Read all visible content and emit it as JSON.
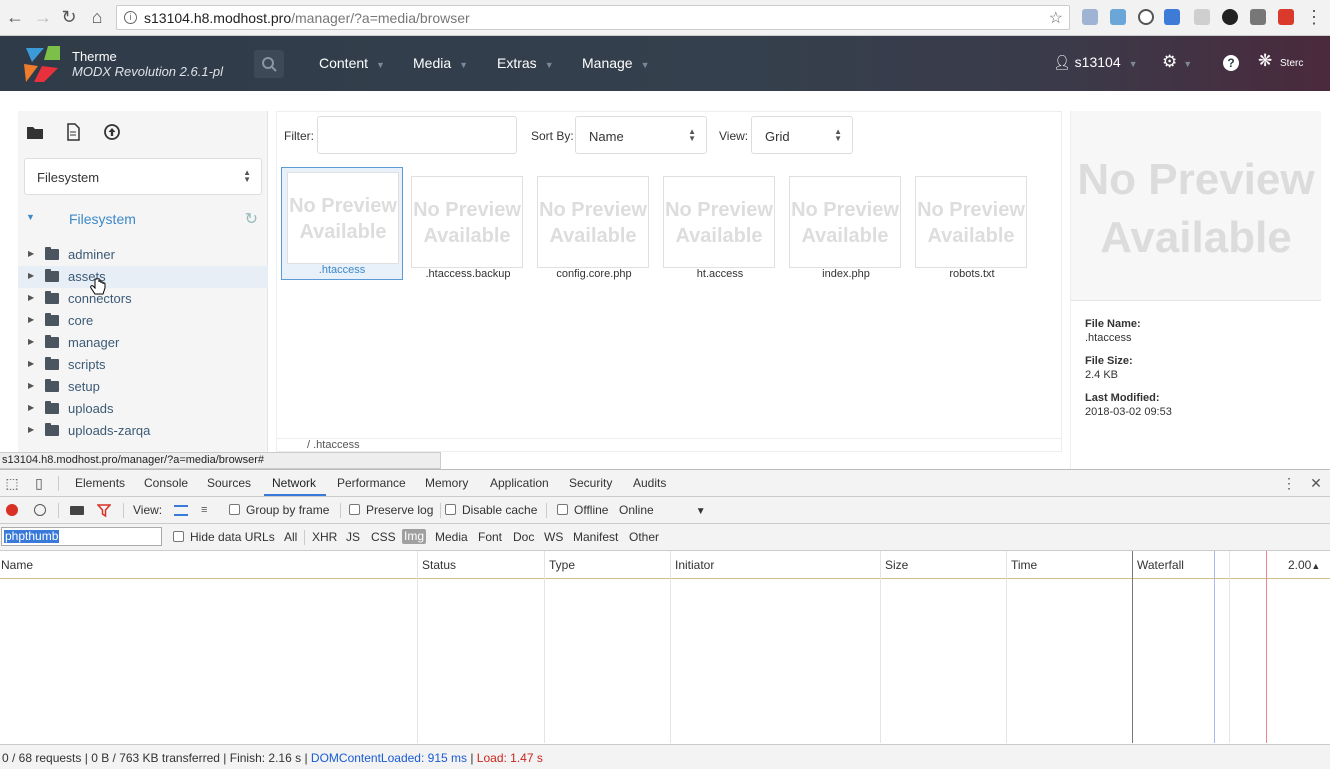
{
  "browser": {
    "url_host": "s13104.h8.modhost.pro",
    "url_path": "/manager/?a=media/browser"
  },
  "modx": {
    "site_name": "Therme",
    "version": "MODX Revolution 2.6.1-pl",
    "nav": [
      "Content",
      "Media",
      "Extras",
      "Manage"
    ],
    "username": "s13104",
    "brand": "Sterc"
  },
  "left_panel": {
    "source": "Filesystem",
    "tree_root": "Filesystem",
    "folders": [
      "adminer",
      "assets",
      "connectors",
      "core",
      "manager",
      "scripts",
      "setup",
      "uploads",
      "uploads-zarqa"
    ]
  },
  "browser_panel": {
    "filter_label": "Filter:",
    "filter_value": "",
    "sort_label": "Sort By:",
    "sort_value": "Name",
    "view_label": "View:",
    "view_value": "Grid",
    "no_preview": "No Preview Available",
    "files": [
      ".htaccess",
      ".htaccess.backup",
      "config.core.php",
      "ht.access",
      "index.php",
      "robots.txt"
    ],
    "selected_file": ".htaccess",
    "path": "/ .htaccess"
  },
  "details": {
    "big_preview": "No Preview Available",
    "file_name_label": "File Name:",
    "file_name": ".htaccess",
    "file_size_label": "File Size:",
    "file_size": "2.4 KB",
    "last_modified_label": "Last Modified:",
    "last_modified": "2018-03-02 09:53"
  },
  "link_status": "s13104.h8.modhost.pro/manager/?a=media/browser#",
  "devtools": {
    "tabs": [
      "Elements",
      "Console",
      "Sources",
      "Network",
      "Performance",
      "Memory",
      "Application",
      "Security",
      "Audits"
    ],
    "active_tab": "Network",
    "toolbar": {
      "view_label": "View:",
      "group_by_frame": "Group by frame",
      "preserve_log": "Preserve log",
      "disable_cache": "Disable cache",
      "offline": "Offline",
      "throttle": "Online"
    },
    "filter_value": "phpthumb",
    "hide_data_urls": "Hide data URLs",
    "filter_types": [
      "All",
      "XHR",
      "JS",
      "CSS",
      "Img",
      "Media",
      "Font",
      "Doc",
      "WS",
      "Manifest",
      "Other"
    ],
    "active_filter_type": "Img",
    "columns": [
      "Name",
      "Status",
      "Type",
      "Initiator",
      "Size",
      "Time",
      "Waterfall"
    ],
    "waterfall_scale": "2.00",
    "status": {
      "requests": "0 / 68 requests",
      "transferred": "0 B / 763 KB transferred",
      "finish": "Finish: 2.16 s",
      "dom_content_loaded": "DOMContentLoaded: 915 ms",
      "load": "Load: 1.47 s"
    }
  }
}
